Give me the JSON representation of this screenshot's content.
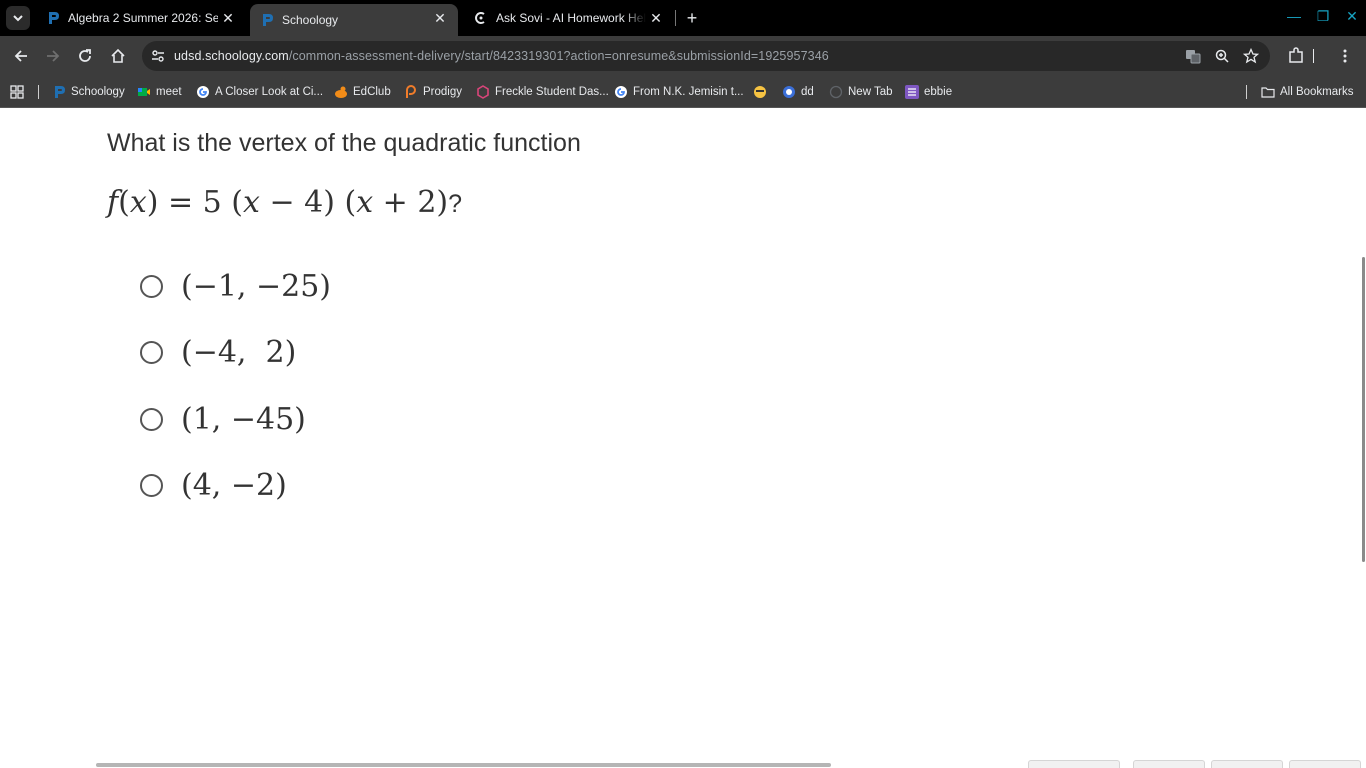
{
  "tabs": [
    {
      "title": "Algebra 2 Summer 2026: Section",
      "icon": "schoology-icon"
    },
    {
      "title": "Schoology",
      "icon": "schoology-icon",
      "active": true
    },
    {
      "title": "Ask Sovi - AI Homework Helper",
      "icon": "sovi-icon"
    }
  ],
  "address_bar": {
    "host": "udsd.schoology.com",
    "path": "/common-assessment-delivery/start/8423319301?action=onresume&submissionId=1925957346"
  },
  "bookmarks": [
    {
      "label": "Schoology",
      "icon": "schoology-icon"
    },
    {
      "label": "meet",
      "icon": "meet-icon"
    },
    {
      "label": "A Closer Look at Ci...",
      "icon": "google-icon"
    },
    {
      "label": "EdClub",
      "icon": "edclub-icon"
    },
    {
      "label": "Prodigy",
      "icon": "prodigy-icon"
    },
    {
      "label": "Freckle Student Das...",
      "icon": "freckle-icon"
    },
    {
      "label": "From N.K. Jemisin t...",
      "icon": "google-icon"
    },
    {
      "label": "",
      "icon": "emoji-icon"
    },
    {
      "label": "dd",
      "icon": "dd-icon"
    },
    {
      "label": "New Tab",
      "icon": "newtab-icon"
    },
    {
      "label": "ebbie",
      "icon": "list-icon"
    }
  ],
  "all_bookmarks_label": "All Bookmarks",
  "question": {
    "prompt": "What is the vertex of the quadratic function",
    "formula_parts": [
      "f",
      "(",
      "x",
      ")",
      " = 5 (",
      "x",
      " − 4) (",
      "x",
      " + 2)"
    ],
    "question_mark": "?"
  },
  "options": [
    {
      "label": "(−1, −25)"
    },
    {
      "label": "(−4,  2)"
    },
    {
      "label": "(1, −45)"
    },
    {
      "label": "(4, −2)"
    }
  ],
  "colors": {
    "chrome_dark": "#000000",
    "toolbar": "#3c3c3c",
    "schoology_blue": "#1f6fb2",
    "window_controls": "#17a3c2"
  }
}
